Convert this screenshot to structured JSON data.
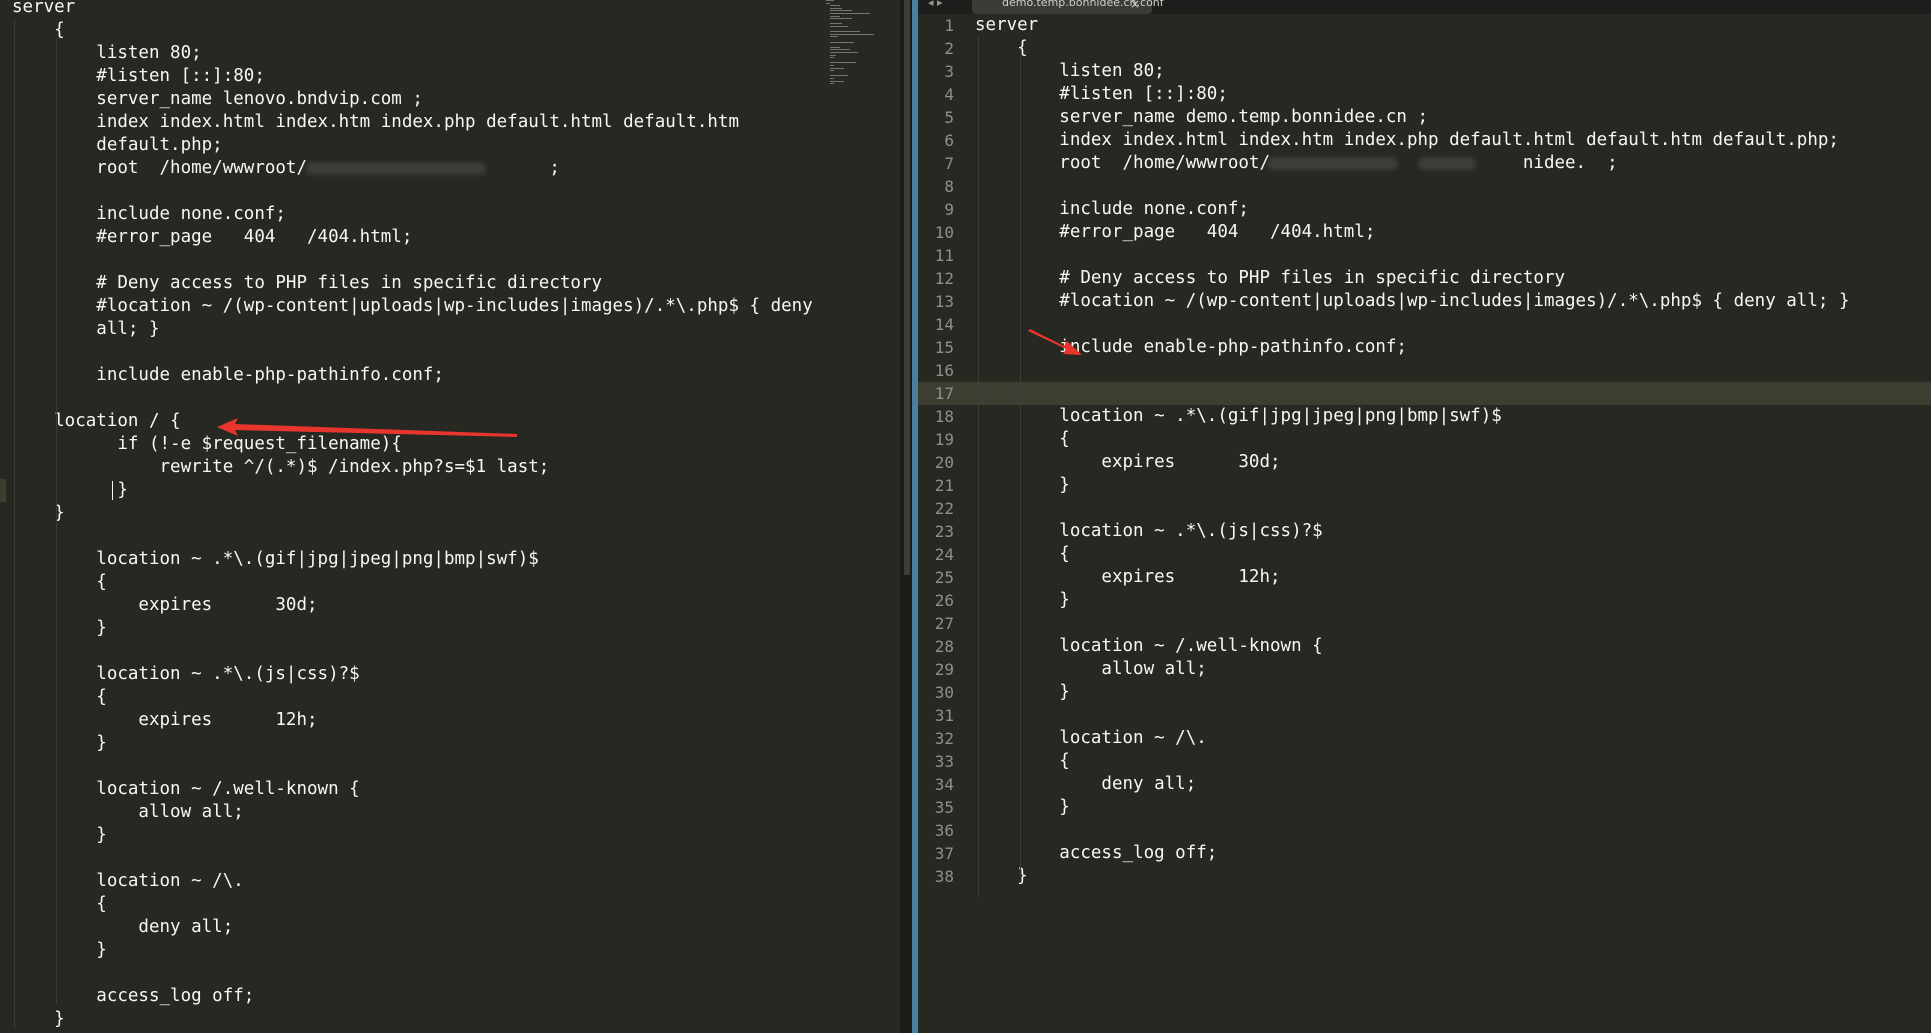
{
  "tab": {
    "title": "demo.temp.bonnidee.cn.conf",
    "close_glyph": "×",
    "nav_arrows": "◂ ▸"
  },
  "left_editor": {
    "lines": [
      "server",
      "    {",
      "        listen 80;",
      "        #listen [::]:80;",
      "        server_name lenovo.bndvip.com ;",
      "        index index.html index.htm index.php default.html default.htm",
      "        default.php;",
      "        root  /home/wwwroot/                       ;",
      "",
      "        include none.conf;",
      "        #error_page   404   /404.html;",
      "",
      "        # Deny access to PHP files in specific directory",
      "        #location ~ /(wp-content|uploads|wp-includes|images)/.*\\.php$ { deny",
      "        all; }",
      "",
      "        include enable-php-pathinfo.conf;",
      "",
      "    location / {",
      "          if (!-e $request_filename){",
      "              rewrite ^/(.*)$ /index.php?s=$1 last;",
      "          }",
      "    }",
      "",
      "        location ~ .*\\.(gif|jpg|jpeg|png|bmp|swf)$",
      "        {",
      "            expires      30d;",
      "        }",
      "",
      "        location ~ .*\\.(js|css)?$",
      "        {",
      "            expires      12h;",
      "        }",
      "",
      "        location ~ /.well-known {",
      "            allow all;",
      "        }",
      "",
      "        location ~ /\\.",
      "        {",
      "            deny all;",
      "        }",
      "",
      "        access_log off;",
      "    }"
    ]
  },
  "right_editor": {
    "current_line": 17,
    "lines": [
      "server",
      "    {",
      "        listen 80;",
      "        #listen [::]:80;",
      "        server_name demo.temp.bonnidee.cn ;",
      "        index index.html index.htm index.php default.html default.htm default.php;",
      "        root  /home/wwwroot/                        nidee.  ;",
      "",
      "        include none.conf;",
      "        #error_page   404   /404.html;",
      "",
      "        # Deny access to PHP files in specific directory",
      "        #location ~ /(wp-content|uploads|wp-includes|images)/.*\\.php$ { deny all; }",
      "",
      "        include enable-php-pathinfo.conf;",
      "",
      "",
      "        location ~ .*\\.(gif|jpg|jpeg|png|bmp|swf)$",
      "        {",
      "            expires      30d;",
      "        }",
      "",
      "        location ~ .*\\.(js|css)?$",
      "        {",
      "            expires      12h;",
      "        }",
      "",
      "        location ~ /.well-known {",
      "            allow all;",
      "        }",
      "",
      "        location ~ /\\.",
      "        {",
      "            deny all;",
      "        }",
      "",
      "        access_log off;",
      "    }"
    ]
  },
  "colors": {
    "editor_bg": "#272822",
    "text": "#f8f8f2",
    "line_number": "#90908a",
    "current_line": "#3e3d32",
    "annotation_arrow": "#e8362f"
  }
}
